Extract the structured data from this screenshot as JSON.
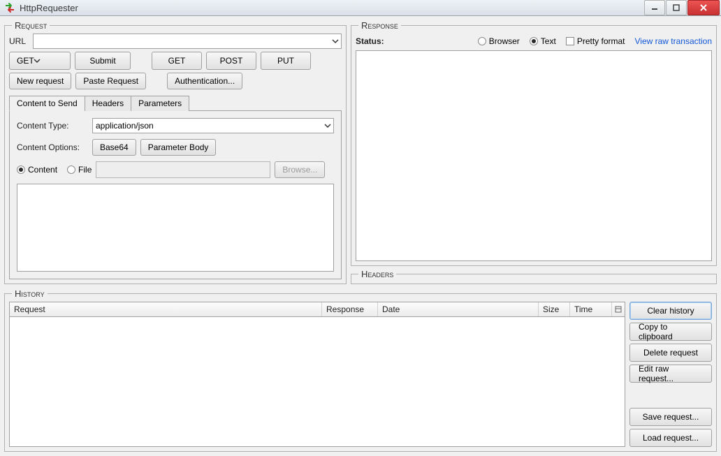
{
  "window": {
    "title": "HttpRequester"
  },
  "request": {
    "legend": "Request",
    "url_label": "URL",
    "url_value": "",
    "method_selected": "GET",
    "buttons": {
      "submit": "Submit",
      "get": "GET",
      "post": "POST",
      "put": "PUT",
      "new_request": "New request",
      "paste_request": "Paste Request",
      "authentication": "Authentication..."
    },
    "tabs": {
      "content_to_send": "Content to Send",
      "headers": "Headers",
      "parameters": "Parameters"
    },
    "content_tab": {
      "content_type_label": "Content Type:",
      "content_type_value": "application/json",
      "content_options_label": "Content Options:",
      "base64_btn": "Base64",
      "parameter_body_btn": "Parameter Body",
      "content_radio": "Content",
      "file_radio": "File",
      "browse_btn": "Browse...",
      "body_value": ""
    }
  },
  "response": {
    "legend": "Response",
    "status_label": "Status:",
    "radio_browser": "Browser",
    "radio_text": "Text",
    "pretty_checkbox": "Pretty format",
    "view_raw_link": "View raw transaction",
    "headers_legend": "Headers"
  },
  "history": {
    "legend": "History",
    "columns": {
      "request": "Request",
      "response": "Response",
      "date": "Date",
      "size": "Size",
      "time": "Time"
    },
    "rows": [],
    "buttons": {
      "clear": "Clear history",
      "copy": "Copy to clipboard",
      "delete": "Delete request",
      "edit_raw": "Edit raw request...",
      "save": "Save request...",
      "load": "Load request..."
    }
  }
}
